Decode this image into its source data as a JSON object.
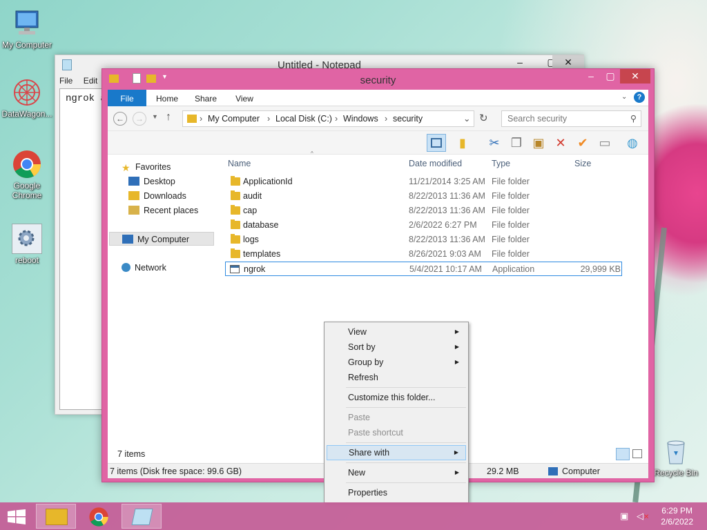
{
  "desktop": {
    "icons": [
      {
        "label": "My Computer"
      },
      {
        "label": "DataWagon..."
      },
      {
        "label": "Google Chrome"
      },
      {
        "label": "reboot"
      },
      {
        "label": "Recycle Bin"
      }
    ]
  },
  "notepad": {
    "title": "Untitled - Notepad",
    "menu": [
      "File",
      "Edit"
    ],
    "text": "ngrok a"
  },
  "explorer": {
    "title": "security",
    "ribbon_tabs": [
      "File",
      "Home",
      "Share",
      "View"
    ],
    "breadcrumb": [
      "My Computer",
      "Local Disk (C:)",
      "Windows",
      "security"
    ],
    "search_placeholder": "Search security",
    "nav": {
      "favorites": "Favorites",
      "desktop": "Desktop",
      "downloads": "Downloads",
      "recent": "Recent places",
      "computer": "My Computer",
      "network": "Network"
    },
    "columns": {
      "name": "Name",
      "date": "Date modified",
      "type": "Type",
      "size": "Size"
    },
    "files": [
      {
        "name": "ApplicationId",
        "date": "11/21/2014 3:25 AM",
        "type": "File folder",
        "size": ""
      },
      {
        "name": "audit",
        "date": "8/22/2013 11:36 AM",
        "type": "File folder",
        "size": ""
      },
      {
        "name": "cap",
        "date": "8/22/2013 11:36 AM",
        "type": "File folder",
        "size": ""
      },
      {
        "name": "database",
        "date": "2/6/2022 6:27 PM",
        "type": "File folder",
        "size": ""
      },
      {
        "name": "logs",
        "date": "8/22/2013 11:36 AM",
        "type": "File folder",
        "size": ""
      },
      {
        "name": "templates",
        "date": "8/26/2021 9:03 AM",
        "type": "File folder",
        "size": ""
      },
      {
        "name": "ngrok",
        "date": "5/4/2021 10:17 AM",
        "type": "Application",
        "size": "29,999 KB"
      }
    ],
    "item_count": "7 items",
    "status_left": "7 items (Disk free space: 99.6 GB)",
    "status_size": "29.2 MB",
    "status_location": "Computer"
  },
  "context_menu": {
    "view": "View",
    "sort_by": "Sort by",
    "group_by": "Group by",
    "refresh": "Refresh",
    "customize": "Customize this folder...",
    "paste": "Paste",
    "paste_shortcut": "Paste shortcut",
    "share_with": "Share with",
    "new": "New",
    "properties": "Properties"
  },
  "taskbar": {
    "time": "6:29 PM",
    "date": "2/6/2022"
  },
  "colors": {
    "accent": "#e064a4",
    "ribbon_file": "#1979ca",
    "taskbar": "#c45b96"
  }
}
